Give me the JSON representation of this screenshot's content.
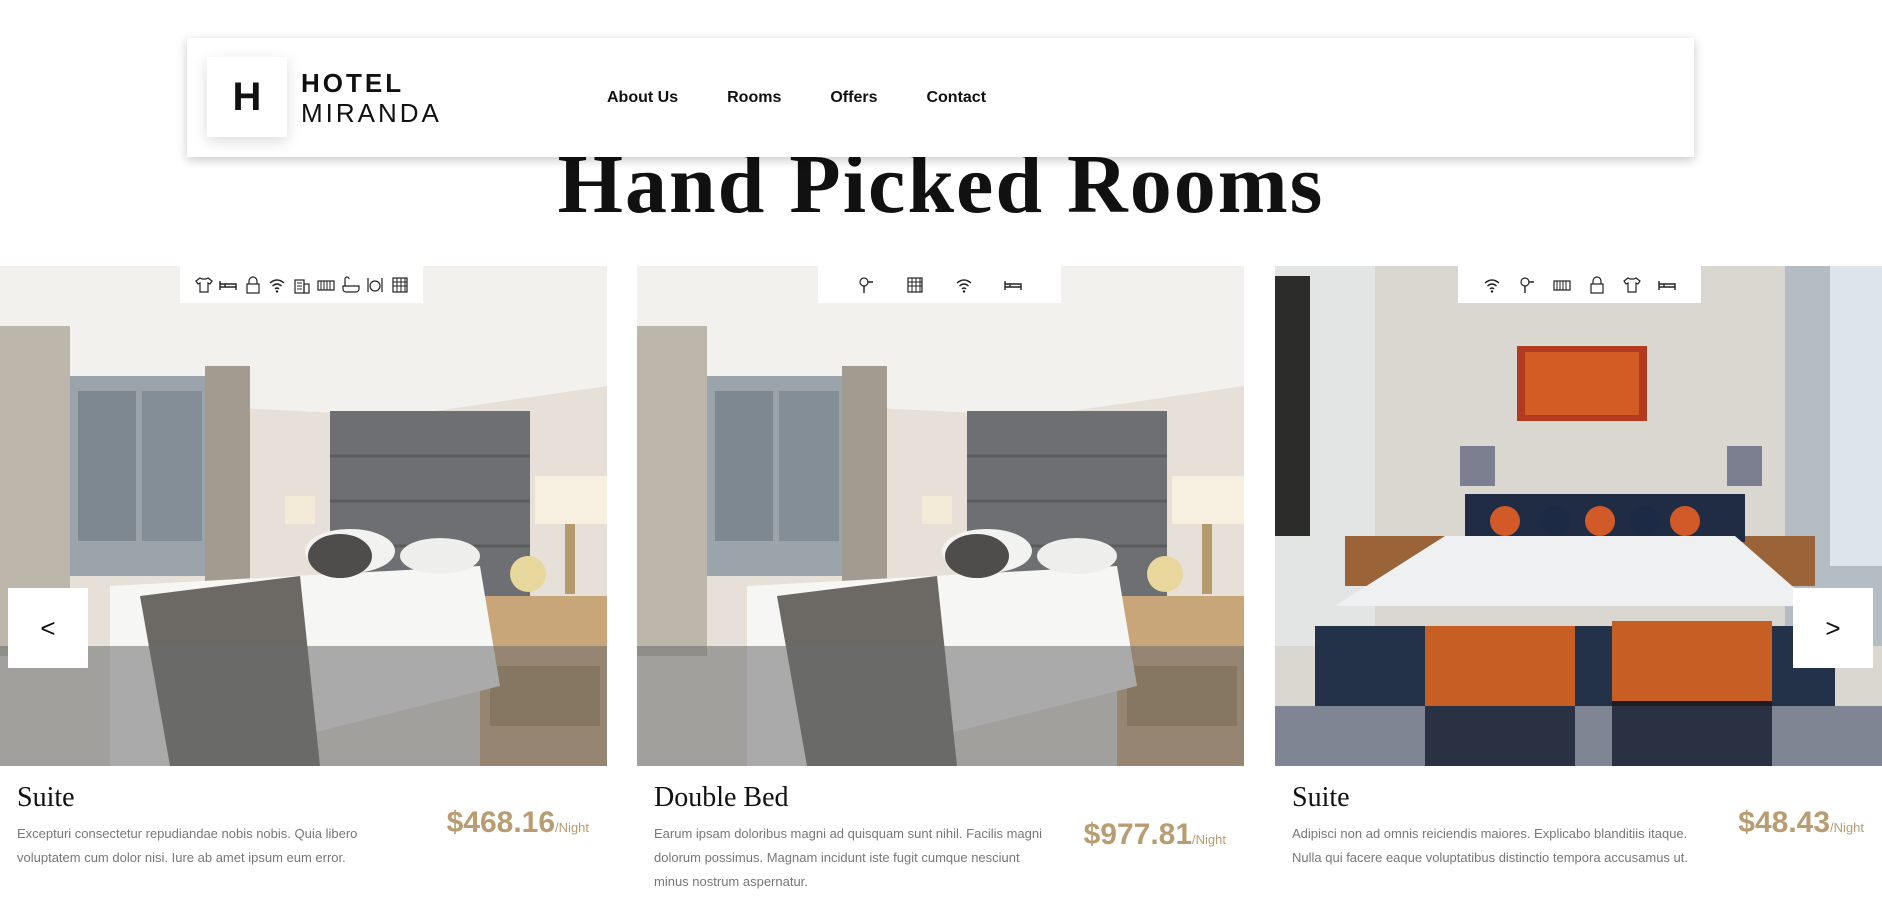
{
  "brand": {
    "logo_letter": "H",
    "name_line1": "HOTEL",
    "name_line2": "MIRANDA"
  },
  "nav": {
    "items": [
      {
        "label": "About Us"
      },
      {
        "label": "Rooms"
      },
      {
        "label": "Offers"
      },
      {
        "label": "Contact"
      }
    ]
  },
  "section": {
    "title": "Hand Picked Rooms"
  },
  "carousel": {
    "prev_label": "<",
    "next_label": ">"
  },
  "rooms": [
    {
      "name": "Suite",
      "description": "Excepturi consectetur repudiandae nobis nobis. Quia libero voluptatem cum dolor nisi. Iure ab amet ipsum eum error.",
      "price": "$468.16",
      "price_unit": "/Night",
      "amenities": [
        "shirt-icon",
        "bed-icon",
        "lock-icon",
        "wifi-icon",
        "building-icon",
        "heater-icon",
        "bathtub-icon",
        "dining-icon",
        "grid-icon"
      ]
    },
    {
      "name": "Double Bed",
      "description": "Earum ipsam doloribus magni ad quisquam sunt nihil. Facilis magni dolorum possimus. Magnam incidunt iste fugit cumque nesciunt minus nostrum aspernatur.",
      "price": "$977.81",
      "price_unit": "/Night",
      "amenities": [
        "hairdryer-icon",
        "grid-icon",
        "wifi-icon",
        "bed-icon"
      ]
    },
    {
      "name": "Suite",
      "description": "Adipisci non ad omnis reiciendis maiores. Explicabo blanditiis itaque. Nulla qui facere eaque voluptatibus distinctio tempora accusamus ut.",
      "price": "$48.43",
      "price_unit": "/Night",
      "amenities": [
        "wifi-icon",
        "hairdryer-icon",
        "heater-icon",
        "lock-icon",
        "shirt-icon",
        "bed-icon"
      ]
    }
  ],
  "colors": {
    "price": "#b89c72",
    "text_muted": "#777777",
    "text_dark": "#111111"
  }
}
